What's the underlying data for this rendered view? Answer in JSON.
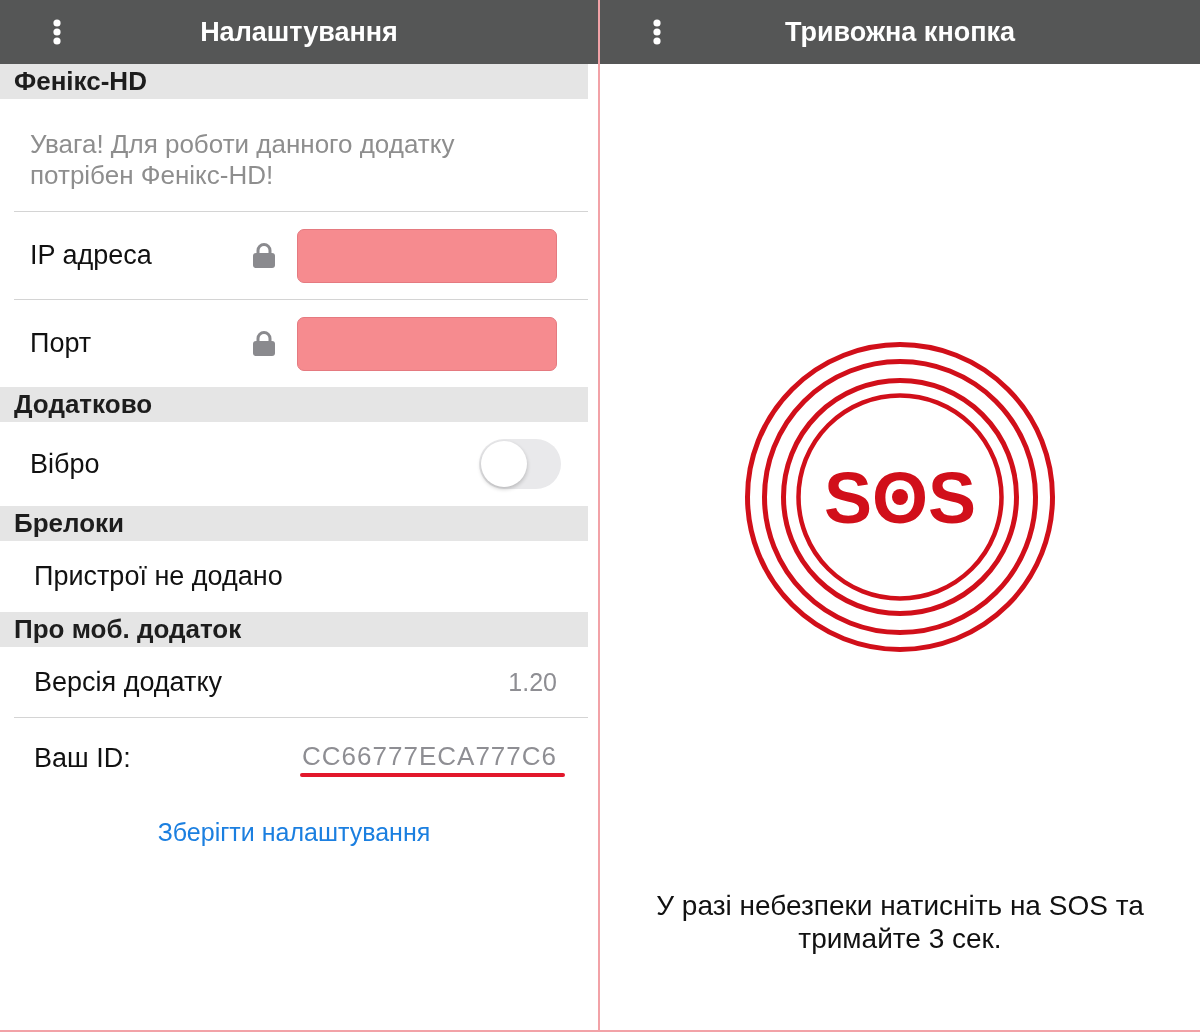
{
  "settings": {
    "title": "Налаштування",
    "sections": [
      {
        "heading": "Фенікс-HD",
        "rows": [
          {
            "kind": "note",
            "text": "Увага! Для роботи данного додатку потрібен Фенікс-HD!"
          },
          {
            "kind": "locked_field",
            "label": "IP адреса",
            "locked": true,
            "invalid": true
          },
          {
            "kind": "locked_field",
            "label": "Порт",
            "locked": true,
            "invalid": true
          }
        ]
      },
      {
        "heading": "Додатково",
        "rows": [
          {
            "kind": "switch",
            "label": "Вібро",
            "on": false
          }
        ]
      },
      {
        "heading": "Брелоки",
        "rows": [
          {
            "kind": "text",
            "label": "Пристрої не додано"
          }
        ]
      },
      {
        "heading": "Про моб. додаток",
        "rows": [
          {
            "kind": "value",
            "label": "Версія додатку",
            "value": "1.20",
            "underlined": false
          },
          {
            "kind": "value",
            "label": "Ваш ID:",
            "value": "CC66777ECA777C6",
            "underlined": true
          }
        ]
      }
    ],
    "save_link": "Зберігти налаштування"
  },
  "alarm": {
    "title": "Тривожна кнопка",
    "sos_label": "SOS",
    "hint": "У разі небезпеки натисніть на SOS та тримайте 3 сек."
  }
}
